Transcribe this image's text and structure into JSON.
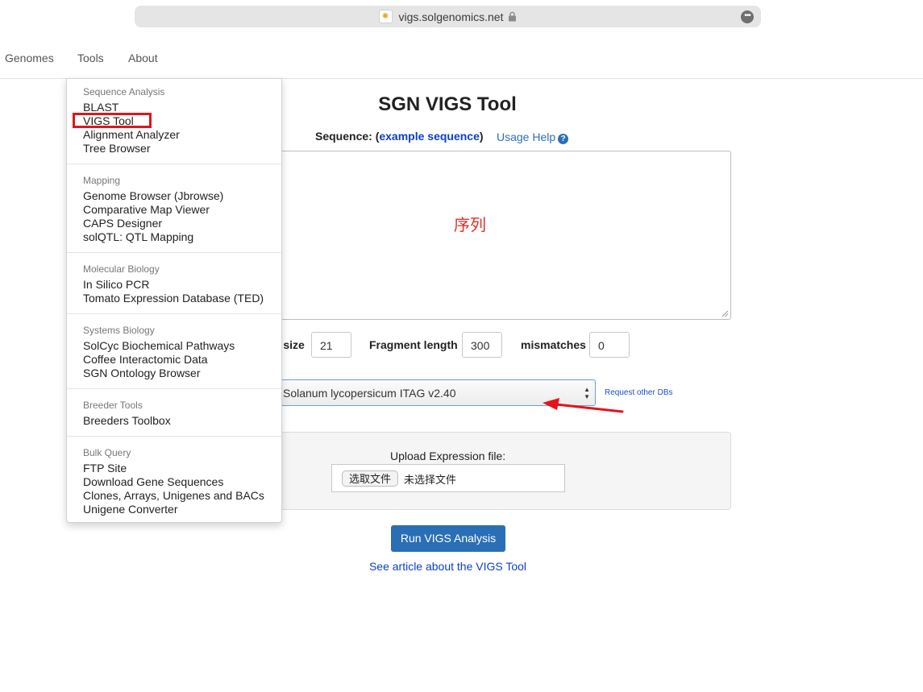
{
  "browser": {
    "url": "vigs.solgenomics.net",
    "icons": {
      "favicon": "sgn-favicon",
      "lock": "lock-icon",
      "more": "more-options-icon"
    }
  },
  "nav": {
    "items": [
      "Genomes",
      "Tools",
      "About"
    ]
  },
  "dropdown": {
    "sections": [
      {
        "header": "Sequence Analysis",
        "items": [
          "BLAST",
          "VIGS Tool",
          "Alignment Analyzer",
          "Tree Browser"
        ]
      },
      {
        "header": "Mapping",
        "items": [
          "Genome Browser (Jbrowse)",
          "Comparative Map Viewer",
          "CAPS Designer",
          "solQTL: QTL Mapping"
        ]
      },
      {
        "header": "Molecular Biology",
        "items": [
          "In Silico PCR",
          "Tomato Expression Database (TED)"
        ]
      },
      {
        "header": "Systems Biology",
        "items": [
          "SolCyc Biochemical Pathways",
          "Coffee Interactomic Data",
          "SGN Ontology Browser"
        ]
      },
      {
        "header": "Breeder Tools",
        "items": [
          "Breeders Toolbox"
        ]
      },
      {
        "header": "Bulk Query",
        "items": [
          "FTP Site",
          "Download Gene Sequences",
          "Clones, Arrays, Unigenes and BACs",
          "Unigene Converter"
        ]
      }
    ],
    "highlighted_item": "VIGS Tool",
    "highlight_color": "#e3141b"
  },
  "main": {
    "title": "SGN VIGS Tool",
    "sequence_label_prefix": "Sequence: (",
    "example_link": "example sequence",
    "sequence_label_suffix": ")",
    "usage_help": "Usage Help",
    "help_icon": "question-circle-icon",
    "sequence_annotation": "序列",
    "params": {
      "nmer_label_visible": "r size",
      "nmer_value": "21",
      "fragment_label": "Fragment length",
      "fragment_value": "300",
      "mismatch_label": "mismatches",
      "mismatch_value": "0"
    },
    "database": {
      "selected": "Solanum lycopersicum ITAG v2.40",
      "request_link": "Request other DBs"
    },
    "upload": {
      "label": "Upload Expression file:",
      "choose_button": "选取文件",
      "no_file_text": "未选择文件"
    },
    "run_button": "Run VIGS Analysis",
    "article_link": "See article about the VIGS Tool"
  },
  "colors": {
    "primary_button": "#2a6fb5",
    "link": "#0a3fcf",
    "annotation_red": "#d93025"
  }
}
